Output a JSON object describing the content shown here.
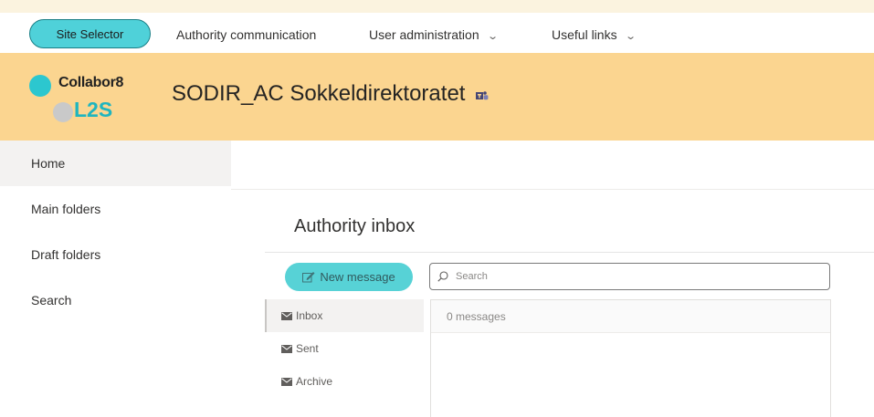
{
  "topnav": {
    "site_selector": "Site Selector",
    "links": [
      {
        "label": "Authority communication",
        "has_dropdown": false
      },
      {
        "label": "User administration",
        "has_dropdown": true
      },
      {
        "label": "Useful links",
        "has_dropdown": true
      }
    ]
  },
  "header": {
    "logo_brand": "Collabor8",
    "logo_sub": "L2S",
    "site_title": "SODIR_AC Sokkeldirektoratet",
    "title_icon": "teams-icon",
    "band_color": "#fbd590"
  },
  "leftnav": {
    "items": [
      {
        "label": "Home",
        "active": true
      },
      {
        "label": "Main folders",
        "active": false
      },
      {
        "label": "Draft folders",
        "active": false
      },
      {
        "label": "Search",
        "active": false
      }
    ]
  },
  "inbox": {
    "title": "Authority inbox",
    "new_message_label": "New message",
    "search_placeholder": "Search",
    "folders": [
      {
        "label": "Inbox",
        "icon": "mail-icon",
        "active": true
      },
      {
        "label": "Sent",
        "icon": "mail-icon",
        "active": false
      },
      {
        "label": "Archive",
        "icon": "mail-icon",
        "active": false
      }
    ],
    "message_count": "0 messages",
    "accent_color": "#57d2d6"
  }
}
